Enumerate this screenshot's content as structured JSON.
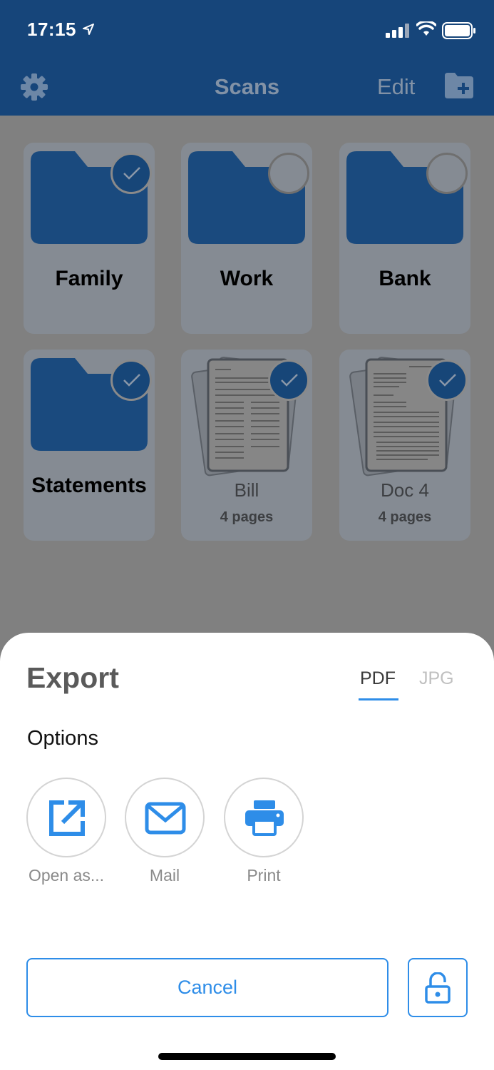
{
  "status": {
    "time": "17:15"
  },
  "nav": {
    "title": "Scans",
    "edit_label": "Edit"
  },
  "grid": {
    "folders": [
      {
        "label": "Family",
        "selected": true
      },
      {
        "label": "Work",
        "selected": false
      },
      {
        "label": "Bank",
        "selected": false
      },
      {
        "label": "Statements",
        "selected": true
      }
    ],
    "documents": [
      {
        "label": "Bill",
        "pages": "4 pages",
        "selected": true
      },
      {
        "label": "Doc 4",
        "pages": "4 pages",
        "selected": true
      }
    ]
  },
  "sheet": {
    "title": "Export",
    "tabs": [
      {
        "label": "PDF",
        "active": true
      },
      {
        "label": "JPG",
        "active": false
      }
    ],
    "options_heading": "Options",
    "options": [
      {
        "label": "Open as...",
        "icon": "open-external-icon"
      },
      {
        "label": "Mail",
        "icon": "mail-icon"
      },
      {
        "label": "Print",
        "icon": "print-icon"
      }
    ],
    "cancel_label": "Cancel"
  },
  "colors": {
    "nav_bg": "#16457a",
    "accent": "#2e8de8",
    "folder": "#1a4a7e",
    "dim_bg": "#808080"
  }
}
